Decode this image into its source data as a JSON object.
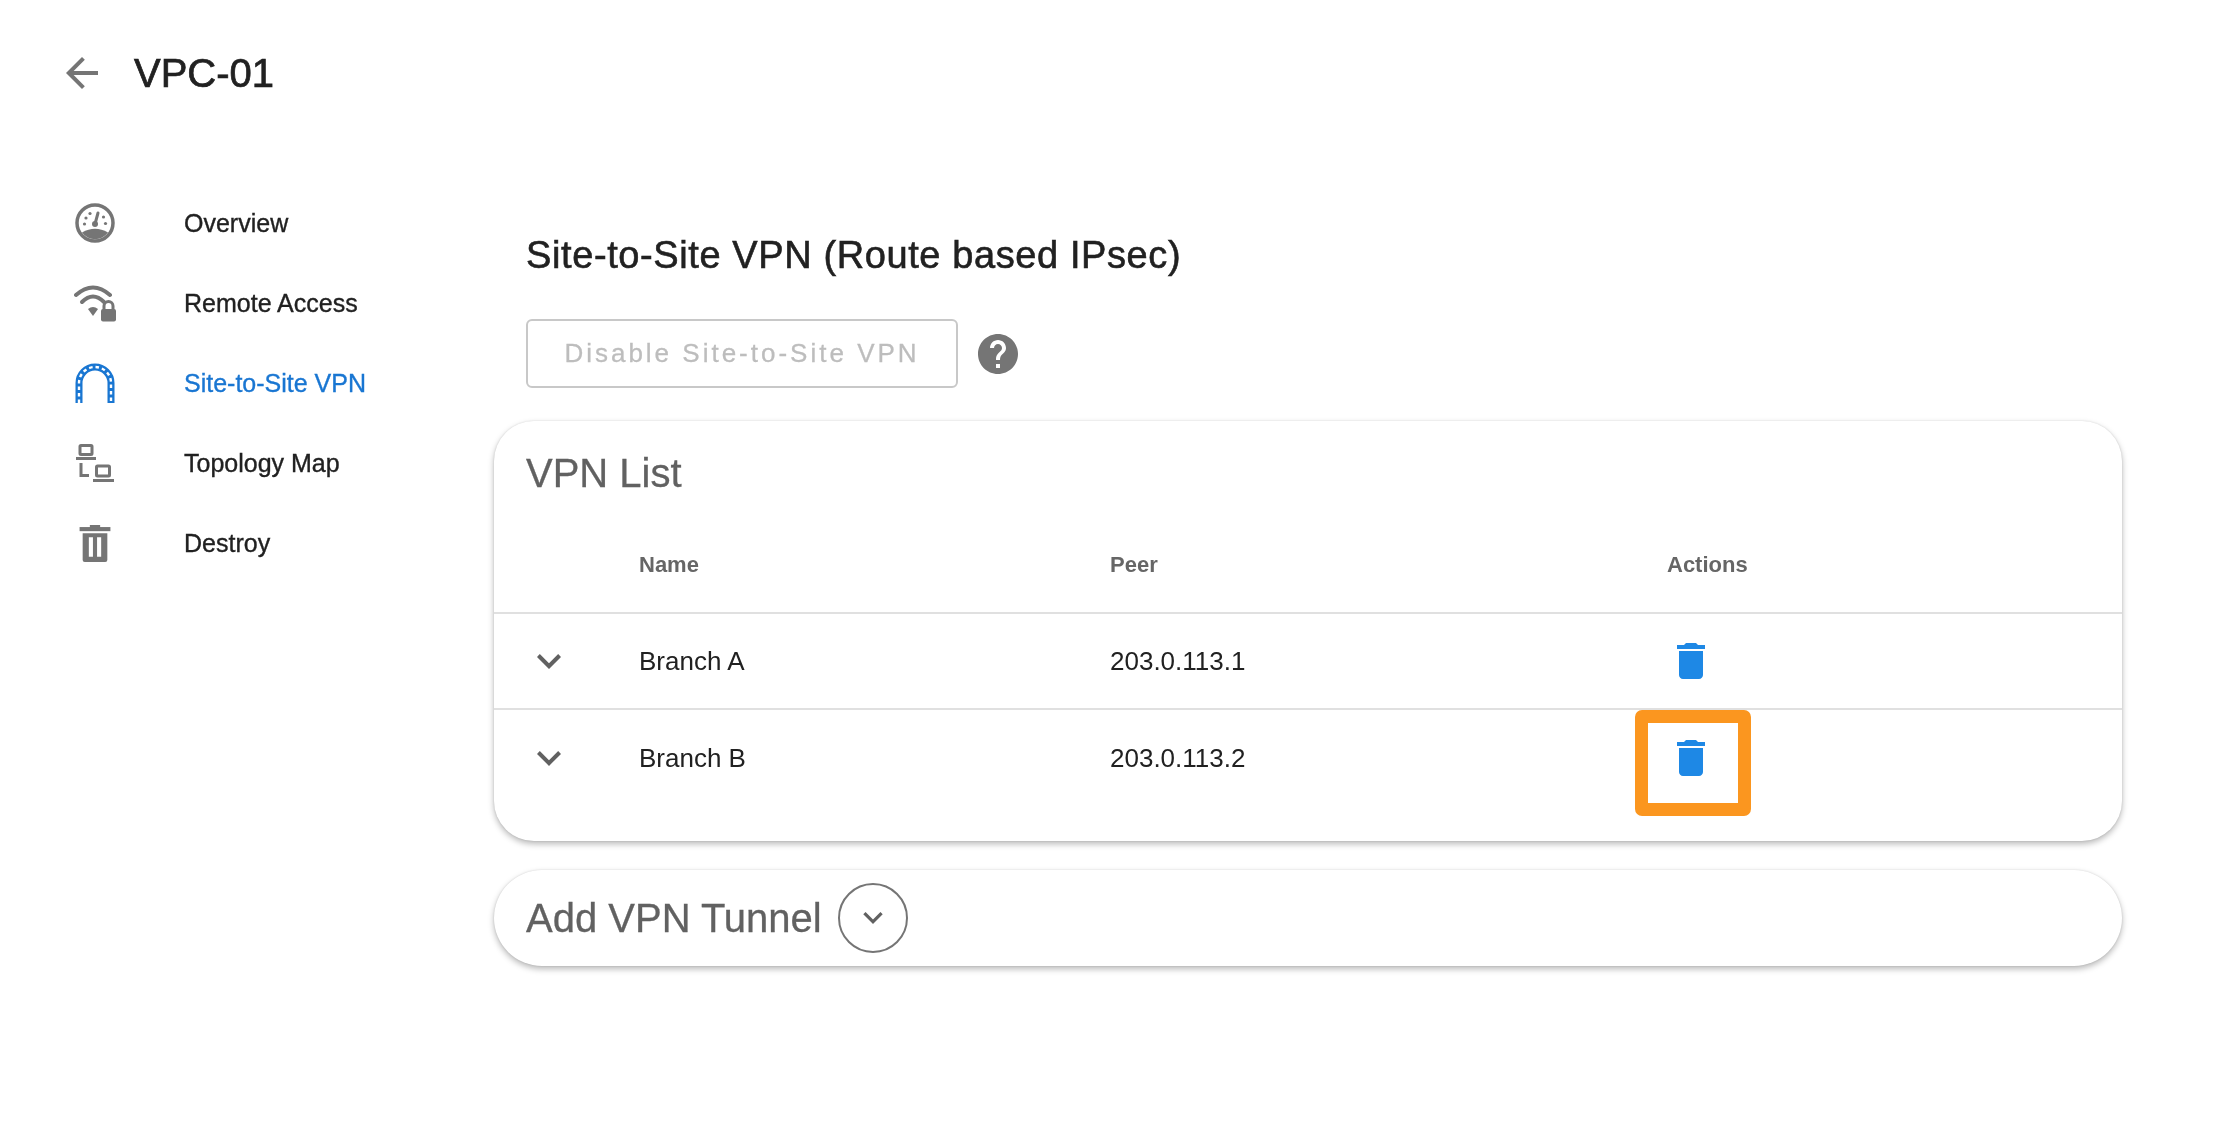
{
  "header": {
    "title": "VPC-01"
  },
  "sidebar": {
    "items": [
      {
        "label": "Overview",
        "selected": false
      },
      {
        "label": "Remote Access",
        "selected": false
      },
      {
        "label": "Site-to-Site VPN",
        "selected": true
      },
      {
        "label": "Topology Map",
        "selected": false
      },
      {
        "label": "Destroy",
        "selected": false
      }
    ]
  },
  "page": {
    "title": "Site-to-Site VPN (Route based IPsec)",
    "disable_button": {
      "label": "Disable Site-to-Site VPN",
      "disabled": true
    }
  },
  "vpn_list": {
    "title": "VPN List",
    "columns": [
      "Name",
      "Peer",
      "Actions"
    ],
    "rows": [
      {
        "name": "Branch A",
        "peer": "203.0.113.1",
        "expanded": false,
        "highlighted": false
      },
      {
        "name": "Branch B",
        "peer": "203.0.113.2",
        "expanded": false,
        "highlighted": true
      }
    ]
  },
  "add_tunnel": {
    "title": "Add VPN Tunnel",
    "expanded": false
  }
}
